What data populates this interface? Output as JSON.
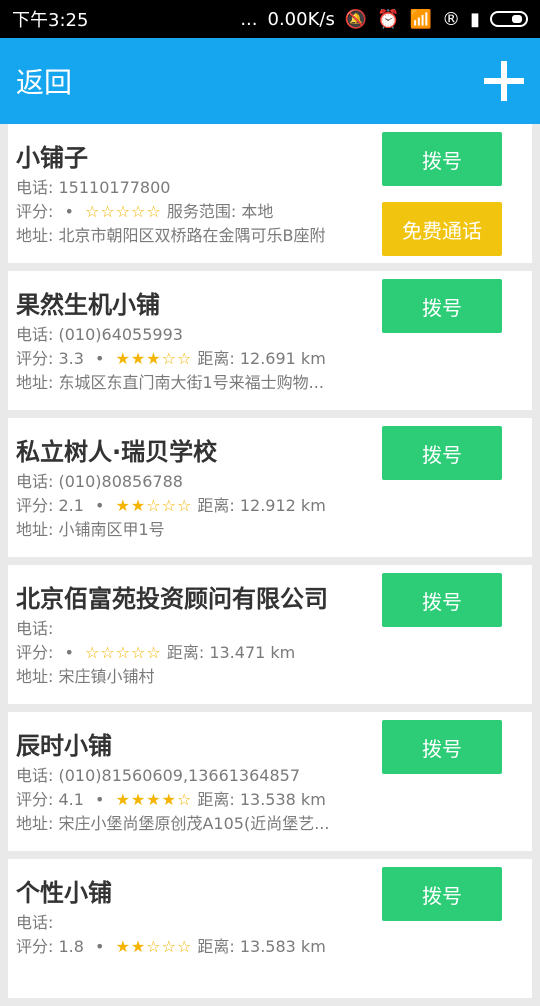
{
  "status": {
    "time": "下午3:25",
    "dots": "...",
    "net": "0.00K/s",
    "icons": [
      "mute-icon",
      "alarm-icon",
      "wifi-icon",
      "registered-icon",
      "signal-icon",
      "battery-icon"
    ]
  },
  "appbar": {
    "back_label": "返回",
    "add_icon": "plus-icon"
  },
  "labels": {
    "phone": "电话: ",
    "rating": "评分: ",
    "distance": "距离: ",
    "address": "地址: ",
    "service_range": "服务范围: "
  },
  "shops": [
    {
      "name": "小铺子",
      "phone": "15110177800",
      "rating": "",
      "stars": "☆☆☆☆☆",
      "extra_label": "服务范围: ",
      "extra_value": "本地",
      "address": "北京市朝阳区双桥路在金隅可乐B座附",
      "call_label": "拨号",
      "free_call_label": "免费通话"
    },
    {
      "name": "果然生机小铺",
      "phone": "(010)64055993",
      "rating": "3.3",
      "stars": "★★★☆☆",
      "extra_label": "距离: ",
      "extra_value": "12.691 km",
      "address": "东城区东直门南大街1号来福士购物...",
      "call_label": "拨号"
    },
    {
      "name": "私立树人·瑞贝学校",
      "phone": "(010)80856788",
      "rating": "2.1",
      "stars": "★★☆☆☆",
      "extra_label": "距离: ",
      "extra_value": "12.912 km",
      "address": "小铺南区甲1号",
      "call_label": "拨号"
    },
    {
      "name": "北京佰富苑投资顾问有限公司",
      "phone": "",
      "rating": "",
      "stars": "☆☆☆☆☆",
      "extra_label": "距离: ",
      "extra_value": "13.471 km",
      "address": "宋庄镇小铺村",
      "call_label": "拨号"
    },
    {
      "name": "辰时小铺",
      "phone": "(010)81560609,13661364857",
      "rating": "4.1",
      "stars": "★★★★☆",
      "extra_label": "距离: ",
      "extra_value": "13.538 km",
      "address": "宋庄小堡尚堡原创茂A105(近尚堡艺...",
      "call_label": "拨号"
    },
    {
      "name": "个性小铺",
      "phone": "",
      "rating": "1.8",
      "stars": "★★☆☆☆",
      "extra_label": "距离: ",
      "extra_value": "13.583 km",
      "address": "",
      "call_label": "拨号"
    }
  ]
}
